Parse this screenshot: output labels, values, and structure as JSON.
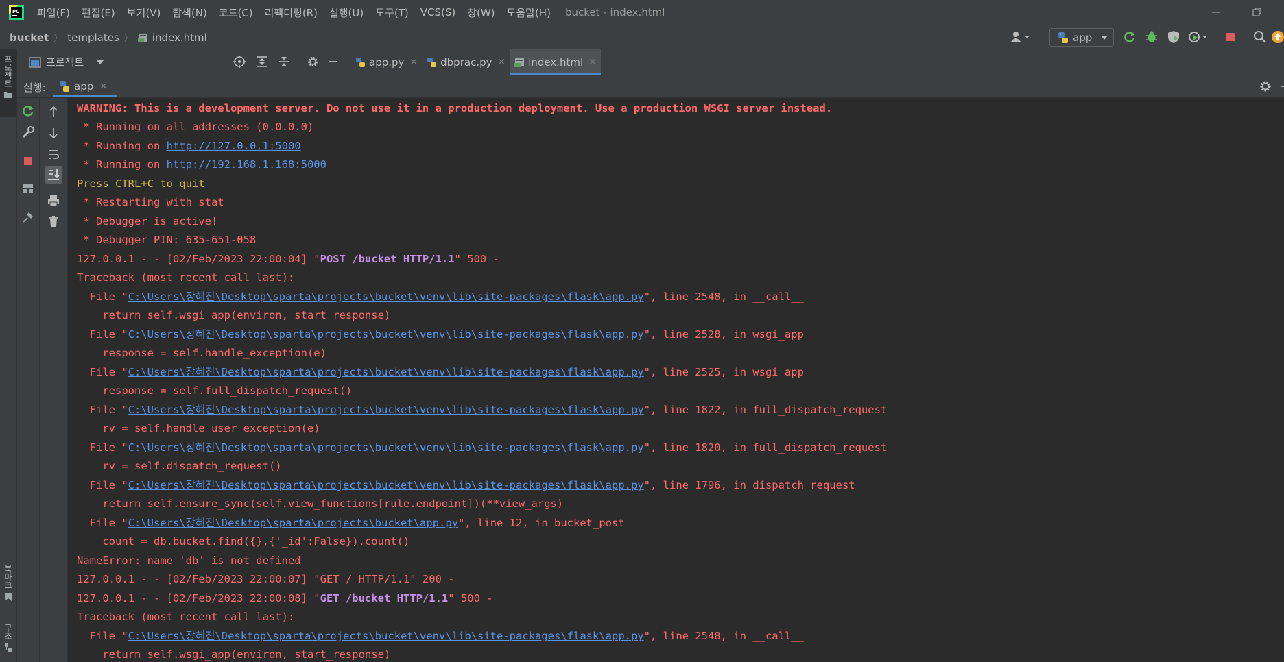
{
  "titlebar": {
    "menu": [
      "파일(F)",
      "편집(E)",
      "보기(V)",
      "탐색(N)",
      "코드(C)",
      "리팩터링(R)",
      "실행(U)",
      "도구(T)",
      "VCS(S)",
      "창(W)",
      "도움말(H)"
    ],
    "window_title": "bucket - index.html"
  },
  "breadcrumb": {
    "project": "bucket",
    "folder": "templates",
    "file": "index.html"
  },
  "toolbar": {
    "run_config": "app"
  },
  "left_strip": {
    "project_tab": "프로젝트",
    "bookmarks_tab": "북마크",
    "structure_tab": "구조"
  },
  "project_panel": {
    "label": "프로젝트"
  },
  "editor_tabs": [
    {
      "label": "app.py",
      "icon": "python-file-icon"
    },
    {
      "label": "dbprac.py",
      "icon": "python-file-icon"
    },
    {
      "label": "index.html",
      "icon": "html-file-icon",
      "active": true
    }
  ],
  "run_panel": {
    "title": "실행:",
    "tab": "app"
  },
  "colors": {
    "error": "#ff6b68",
    "link": "#5894e8",
    "warning_yellow": "#d6b850",
    "accent": "#4a88c7"
  },
  "console": {
    "l1": "WARNING: This is a development server. Do not use it in a production deployment. Use a production WSGI server instead.",
    "l2": " * Running on all addresses (0.0.0.0)",
    "l3_pre": " * Running on ",
    "l3_link": "http://127.0.0.1:5000",
    "l4_pre": " * Running on ",
    "l4_link": "http://192.168.1.168:5000",
    "l5": "Press CTRL+C to quit",
    "l6": " * Restarting with stat",
    "l7": " * Debugger is active!",
    "l8": " * Debugger PIN: 635-651-058",
    "l9_pre": "127.0.0.1 - - [02/Feb/2023 22:00:04] \"",
    "l9_bold": "POST /bucket HTTP/1.1",
    "l9_post": "\" 500 -",
    "l10": "Traceback (most recent call last):",
    "file_pre": "  File \"",
    "flask_path": "C:\\Users\\장혜진\\Desktop\\sparta\\projects\\bucket\\venv\\lib\\site-packages\\flask\\app.py",
    "bucket_path": "C:\\Users\\장혜진\\Desktop\\sparta\\projects\\bucket\\app.py",
    "l11_post": "\", line 2548, in __call__",
    "l12": "    return self.wsgi_app(environ, start_response)",
    "l13_post": "\", line 2528, in wsgi_app",
    "l14": "    response = self.handle_exception(e)",
    "l15_post": "\", line 2525, in wsgi_app",
    "l16": "    response = self.full_dispatch_request()",
    "l17_post": "\", line 1822, in full_dispatch_request",
    "l18": "    rv = self.handle_user_exception(e)",
    "l19_post": "\", line 1820, in full_dispatch_request",
    "l20": "    rv = self.dispatch_request()",
    "l21_post": "\", line 1796, in dispatch_request",
    "l22": "    return self.ensure_sync(self.view_functions[rule.endpoint])(**view_args)",
    "l23_post": "\", line 12, in bucket_post",
    "l24": "    count = db.bucket.find({},{'_id':False}).count()",
    "l25": "NameError: name 'db' is not defined",
    "l26": "127.0.0.1 - - [02/Feb/2023 22:00:07] \"GET / HTTP/1.1\" 200 -",
    "l27_pre": "127.0.0.1 - - [02/Feb/2023 22:00:08] \"",
    "l27_bold": "GET /bucket HTTP/1.1",
    "l27_post": "\" 500 -",
    "l28": "Traceback (most recent call last):",
    "l29_post": "\", line 2548, in __call__",
    "l30": "    return self.wsgi_app(environ, start_response)"
  }
}
